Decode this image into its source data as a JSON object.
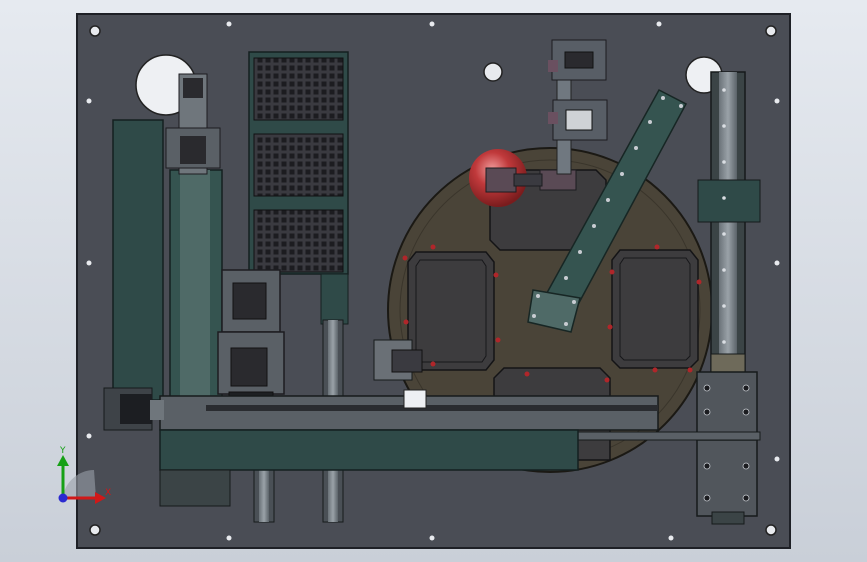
{
  "viewport": {
    "background": "#d3d8e0"
  },
  "model": {
    "plate_color": "#4a4d55",
    "plate_edge": "#202228",
    "frame_color": "#2f4a48",
    "frame_light": "#4f6a67",
    "turntable_color": "#4a4438",
    "tray_color": "#2c2c32",
    "sphere_color": "#c0393b",
    "hole_color": "#f0f2f5"
  },
  "triad": {
    "x_label": "X",
    "y_label": "Y",
    "x_color": "#d01818",
    "y_color": "#16a016",
    "z_color": "#2a2ad0"
  }
}
